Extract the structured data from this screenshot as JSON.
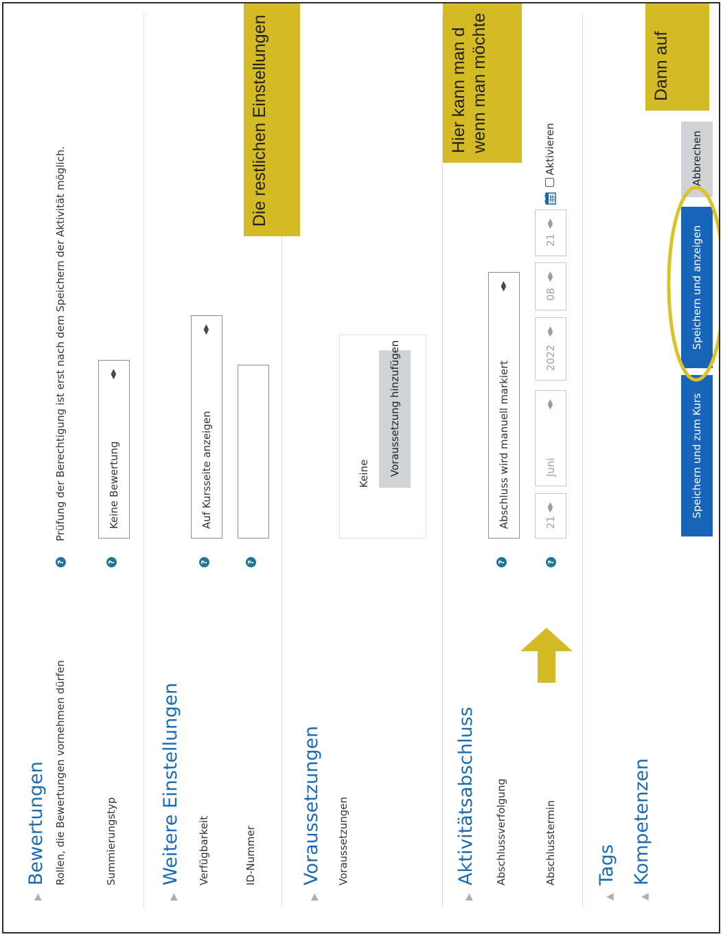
{
  "sections": {
    "bewertungen": {
      "title": "Bewertungen",
      "roles_label": "Rollen, die Bewertungen vornehmen dürfen",
      "roles_text": "Prüfung der Berechtigung ist erst nach dem Speichern der Aktivität möglich.",
      "summary_label": "Summierungstyp",
      "summary_value": "Keine Bewertung"
    },
    "weitere": {
      "title": "Weitere Einstellungen",
      "availability_label": "Verfügbarkeit",
      "availability_value": "Auf Kursseite anzeigen",
      "idnumber_label": "ID-Nummer",
      "idnumber_value": ""
    },
    "voraussetzungen": {
      "title": "Voraussetzungen",
      "label": "Voraussetzungen",
      "none_text": "Keine",
      "add_button": "Voraussetzung hinzufügen"
    },
    "abschluss": {
      "title": "Aktivitätsabschluss",
      "tracking_label": "Abschlussverfolgung",
      "tracking_value": "Abschluss wird manuell markiert",
      "date_label": "Abschlusstermin",
      "date_day": "21",
      "date_month": "Juni",
      "date_year": "2022",
      "date_hour": "08",
      "date_minute": "21",
      "enable_label": "Aktivieren",
      "enable_checked": false
    },
    "tags": {
      "title": "Tags"
    },
    "kompetenzen": {
      "title": "Kompetenzen"
    }
  },
  "buttons": {
    "save_return": "Speichern und zum Kurs",
    "save_display": "Speichern und anzeigen",
    "cancel": "Abbrechen"
  },
  "callouts": {
    "c1": "Die restlichen Einstellungen",
    "c2_line1": "Hier kann man d",
    "c2_line2": "wenn man möchte",
    "c3": "Dann auf"
  },
  "colors": {
    "heading": "#1a6bb3",
    "primary_button": "#1864b8",
    "callout": "#d4bb25",
    "highlight_ellipse": "#d9c328",
    "help_icon": "#1d7895"
  },
  "icons": {
    "collapsed_section": "chevron-right-icon",
    "expanded_section": "chevron-up-icon",
    "help": "help-icon",
    "calendar": "calendar-icon",
    "annotation_arrow": "arrow-right-icon",
    "highlight": "ellipse-highlight"
  }
}
